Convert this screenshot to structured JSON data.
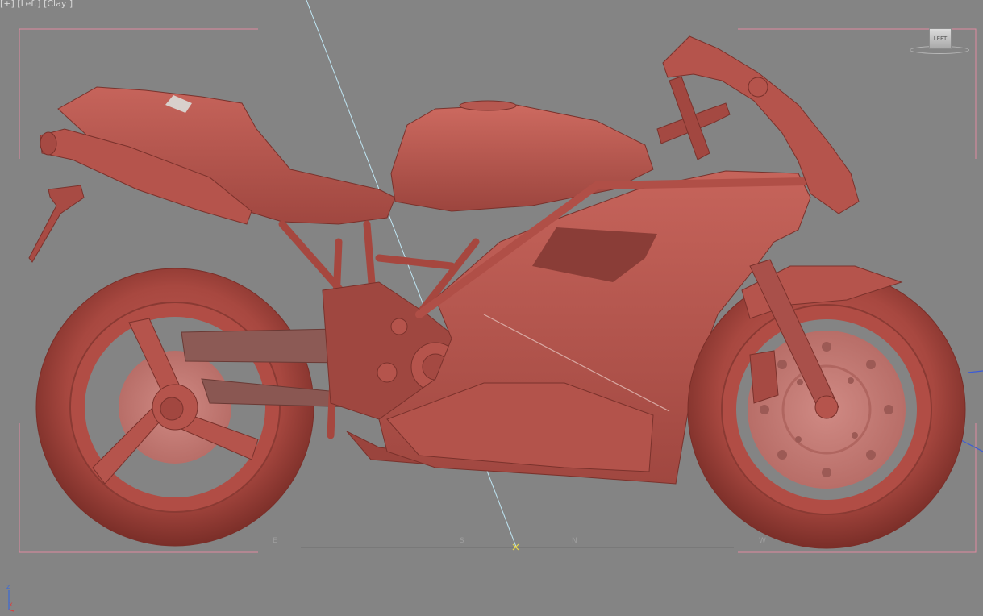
{
  "viewport": {
    "label": "[+] [Left] [Clay ]",
    "background": "#848484",
    "safe_frame_color": "#e08aa0",
    "model_color": "#b5544c"
  },
  "viewcube": {
    "face_label": "LEFT"
  },
  "compass": {
    "e": "E",
    "s": "S",
    "n": "N",
    "w": "W"
  },
  "axis_tripod": {
    "z_label": "z",
    "x_label": "x"
  },
  "icons": [
    "motorcycle-model",
    "viewcube-icon",
    "axis-tripod-icon"
  ]
}
